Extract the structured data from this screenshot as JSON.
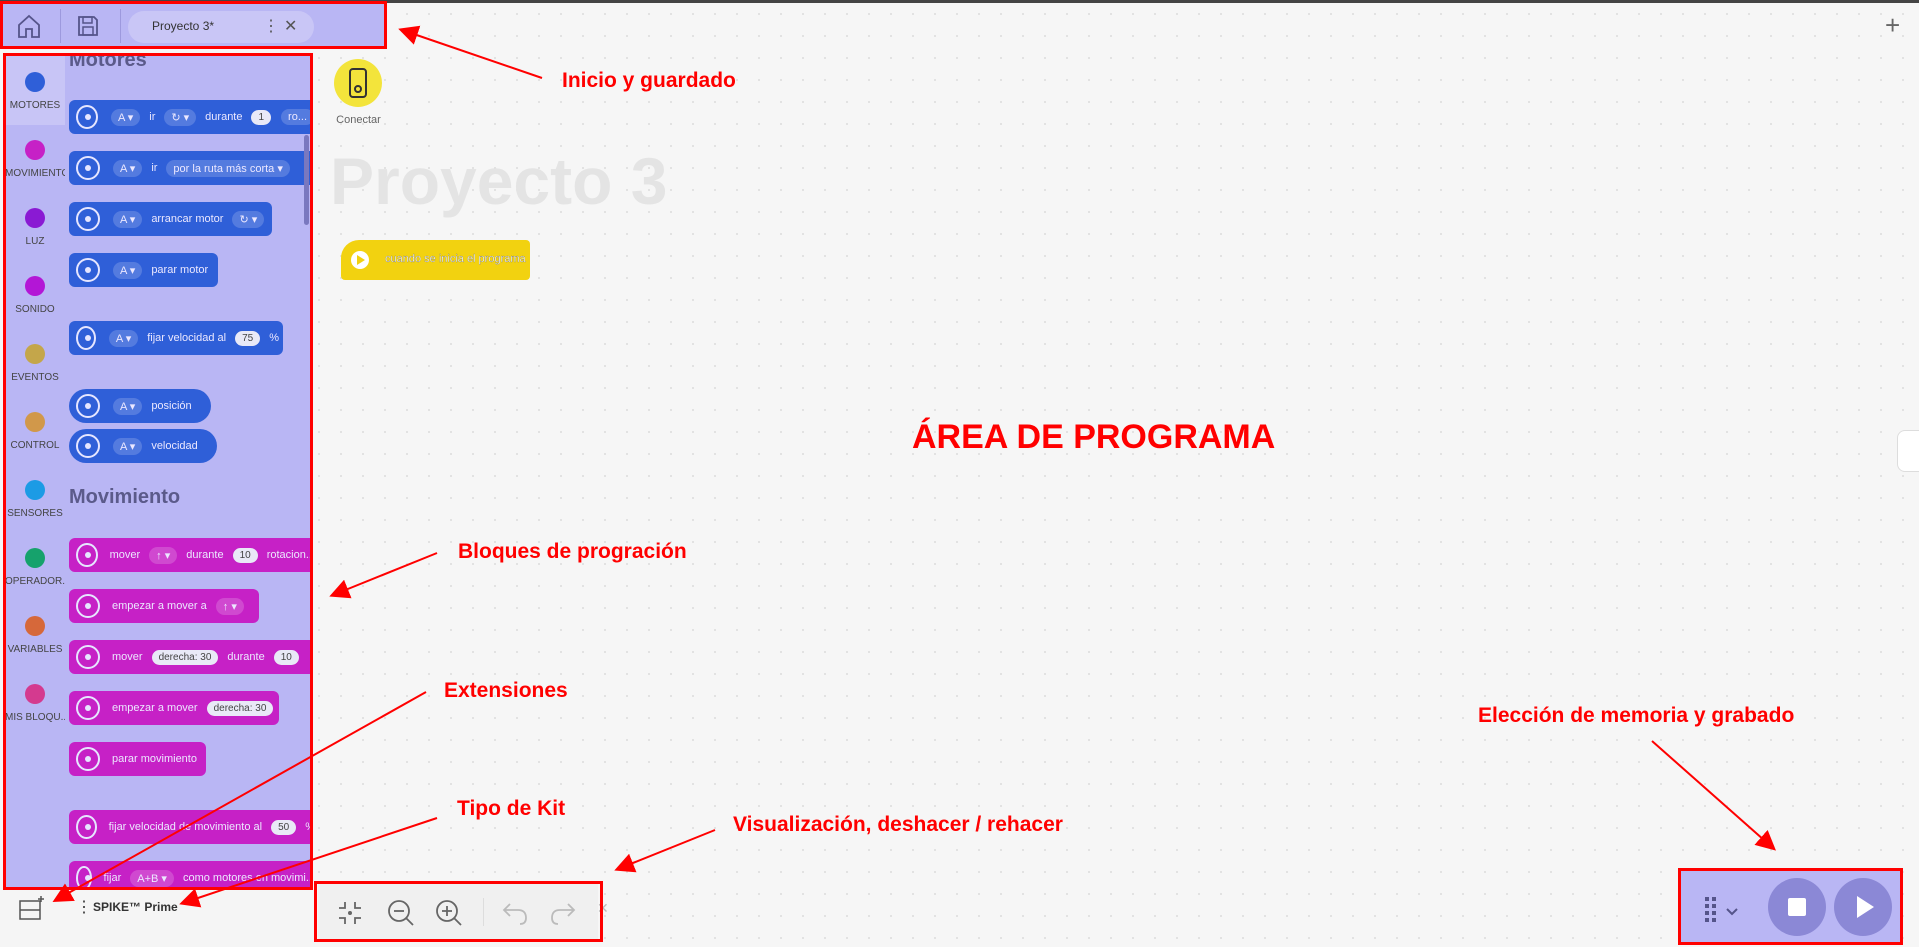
{
  "app": {
    "project_name": "Proyecto 3*",
    "canvas_title": "Proyecto 3"
  },
  "connect": {
    "label": "Conectar"
  },
  "categories": [
    {
      "label": "MOTORES",
      "color": "#2f5fd8"
    },
    {
      "label": "MOVIMIENTO",
      "color": "#c621c6"
    },
    {
      "label": "LUZ",
      "color": "#8a1ad3"
    },
    {
      "label": "SONIDO",
      "color": "#b316d6"
    },
    {
      "label": "EVENTOS",
      "color": "#c4a64a"
    },
    {
      "label": "CONTROL",
      "color": "#d1984a"
    },
    {
      "label": "SENSORES",
      "color": "#1c9be5"
    },
    {
      "label": "OPERADOR...",
      "color": "#16a26c"
    },
    {
      "label": "VARIABLES",
      "color": "#d6683a"
    },
    {
      "label": "MIS BLOQU...",
      "color": "#d43a8f"
    }
  ],
  "palette": {
    "motores_title": "Motores",
    "movimiento_title": "Movimiento",
    "motor_blocks": {
      "b1": {
        "port": "A",
        "ir": "ir",
        "durante": "durante",
        "value": "1",
        "unit": "ro..."
      },
      "b2": {
        "port": "A",
        "ir": "ir",
        "route": "por la ruta más corta"
      },
      "b3": {
        "port": "A",
        "text": "arrancar motor"
      },
      "b4": {
        "port": "A",
        "text": "parar motor"
      },
      "b5": {
        "port": "A",
        "text": "fijar velocidad al",
        "value": "75",
        "unit": "%"
      },
      "b6": {
        "port": "A",
        "text": "posición"
      },
      "b7": {
        "port": "A",
        "text": "velocidad"
      }
    },
    "move_blocks": {
      "m1": {
        "text": "mover",
        "durante": "durante",
        "value": "10",
        "unit": "rotacion..."
      },
      "m2": {
        "text": "empezar a mover a"
      },
      "m3": {
        "text": "mover",
        "steer": "derecha: 30",
        "durante": "durante",
        "value": "10"
      },
      "m4": {
        "text": "empezar a mover",
        "steer": "derecha: 30"
      },
      "m5": {
        "text": "parar movimiento"
      },
      "m6": {
        "text": "fijar velocidad de movimiento al",
        "value": "50",
        "unit": "%"
      },
      "m7": {
        "text": "fijar",
        "ports": "A+B",
        "rest": "como motores en movimi..."
      }
    }
  },
  "start_block": {
    "label": "cuando se inicia el programa"
  },
  "kit": {
    "name": "SPIKE™ Prime"
  },
  "annotations": {
    "area": "ÁREA DE PROGRAMA",
    "inicio": "Inicio y guardado",
    "bloques": "Bloques de progración",
    "extensiones": "Extensiones",
    "kit": "Tipo de Kit",
    "visualizacion": "Visualización, deshacer / rehacer",
    "memoria": "Elección de memoria y grabado"
  },
  "colors": {
    "accent": "#b9b6f4",
    "annotation": "#ff0000",
    "motor": "#2f5fd8",
    "movement": "#c621c6",
    "event": "#f2d210"
  }
}
